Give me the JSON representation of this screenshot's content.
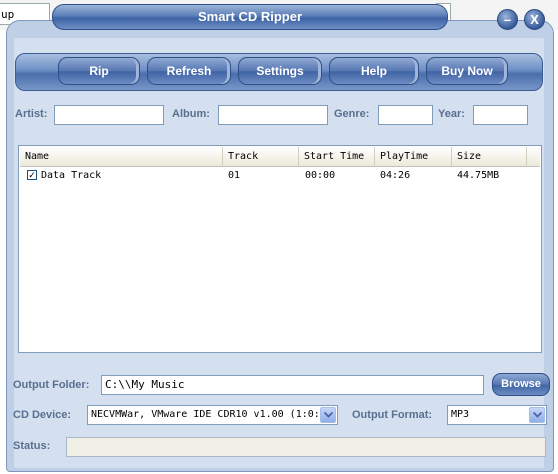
{
  "background": {
    "field_text": "up"
  },
  "window": {
    "title": "Smart CD Ripper",
    "minimize_glyph": "–",
    "close_glyph": "X"
  },
  "toolbar": {
    "rip": "Rip",
    "refresh": "Refresh",
    "settings": "Settings",
    "help": "Help",
    "buy_now": "Buy Now"
  },
  "meta": {
    "artist_label": "Artist:",
    "artist_value": "",
    "album_label": "Album:",
    "album_value": "",
    "genre_label": "Genre:",
    "genre_value": "",
    "year_label": "Year:",
    "year_value": ""
  },
  "tracks": {
    "columns": [
      "Name",
      "Track",
      "Start Time",
      "PlayTime",
      "Size"
    ],
    "rows": [
      {
        "checked": true,
        "name": "Data Track",
        "track": "01",
        "start": "00:00",
        "playtime": "04:26",
        "size": "44.75MB"
      }
    ]
  },
  "output": {
    "folder_label": "Output Folder:",
    "folder_value": "C:\\\\My Music",
    "browse": "Browse",
    "device_label": "CD Device:",
    "device_value": "NECVMWar, VMware IDE CDR10 v1.00 (1:0:",
    "format_label": "Output Format:",
    "format_value": "MP3",
    "status_label": "Status:",
    "status_value": ""
  },
  "colors": {
    "accent": "#3d63a4",
    "panel": "#d4e0f0",
    "label": "#5a6f8f"
  }
}
